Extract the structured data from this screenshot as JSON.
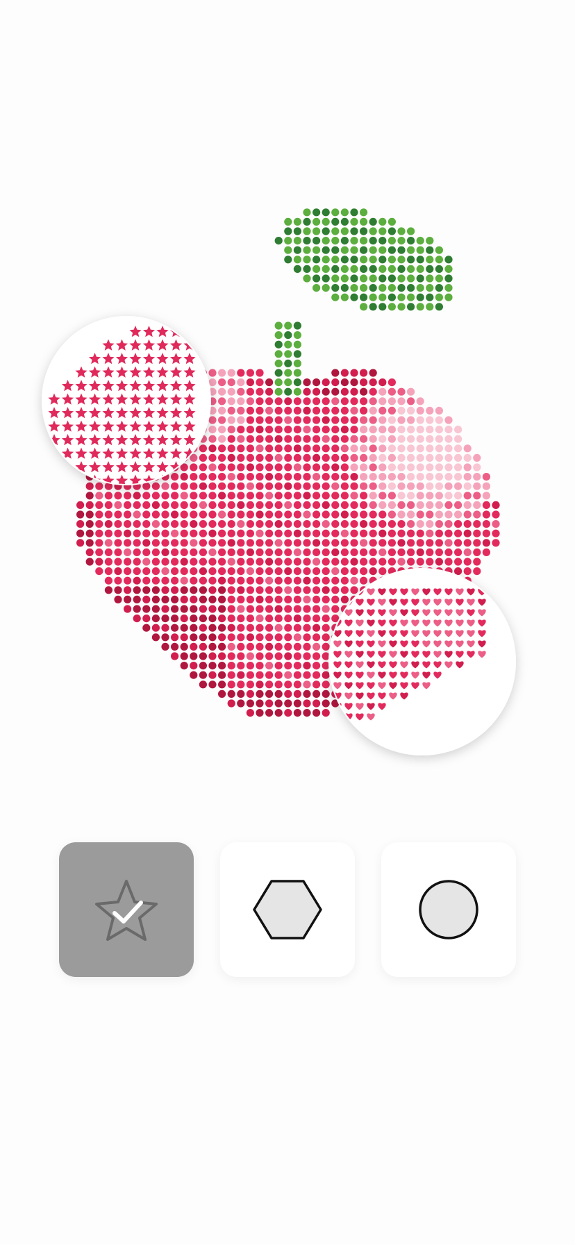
{
  "artwork": {
    "subject": "apple",
    "colors": {
      "red_dark": "#b0173f",
      "red_mid": "#d11e4e",
      "red": "#e32a5c",
      "pink": "#ec5e86",
      "pink_light": "#f5a3bb",
      "pink_pale": "#f9c6d4",
      "leaf_dark": "#2f7d32",
      "leaf_light": "#5cae3e",
      "background": "#fdfdfd"
    },
    "magnifiers": [
      {
        "name": "stars-preview",
        "pattern": "star",
        "color": "#e02a5b"
      },
      {
        "name": "hearts-preview",
        "pattern": "heart",
        "color": "#e02a5b"
      }
    ]
  },
  "shape_picker": {
    "selected": "star",
    "options": [
      {
        "id": "star",
        "icon": "star-icon",
        "selected": true,
        "tile_color": "#9b9b9b"
      },
      {
        "id": "hexagon",
        "icon": "hexagon-icon",
        "selected": false,
        "tile_color": "#ffffff"
      },
      {
        "id": "circle",
        "icon": "circle-icon",
        "selected": false,
        "tile_color": "#ffffff"
      }
    ]
  }
}
